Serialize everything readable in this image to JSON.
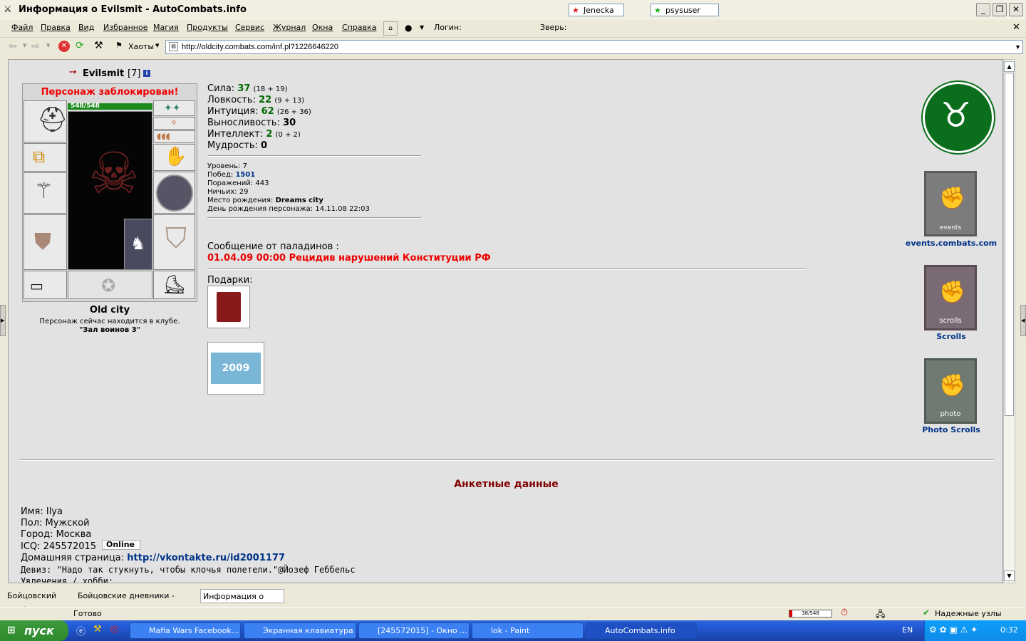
{
  "window": {
    "title": "Информация о Evilsmit - AutoCombats.info",
    "user1": "Jenecka",
    "user2": "psysuser"
  },
  "menu": [
    "Файл",
    "Правка",
    "Вид",
    "Избранное",
    "Магия",
    "Продукты",
    "Сервис",
    "Журнал",
    "Окна",
    "Справка"
  ],
  "toolbar": {
    "login_label": "Логин:",
    "beast_label": "Зверь:",
    "chaos_label": "Хаоты",
    "url": "http://oldcity.combats.com/inf.pl?1226646220"
  },
  "character": {
    "name": "Evilsmit",
    "level": "[7]",
    "blocked": "Персонаж заблокирован!",
    "hp": "548/548",
    "city": "Old city",
    "location_text": "Персонаж сейчас находится в клубе.",
    "location_room": "\"Зал воинов 3\""
  },
  "stats": [
    {
      "label": "Сила:",
      "value": "37",
      "detail": "(18 + 19)"
    },
    {
      "label": "Ловкость:",
      "value": "22",
      "detail": "(9 + 13)"
    },
    {
      "label": "Интуиция:",
      "value": "62",
      "detail": "(26 + 36)"
    },
    {
      "label": "Выносливость:",
      "value": "30",
      "detail": ""
    },
    {
      "label": "Интеллект:",
      "value": "2",
      "detail": "(0 + 2)"
    },
    {
      "label": "Мудрость:",
      "value": "0",
      "detail": ""
    }
  ],
  "info": {
    "level": "Уровень: 7",
    "wins_label": "Побед:",
    "wins": "1501",
    "losses": "Поражений: 443",
    "draws": "Ничьих: 29",
    "birthplace_label": "Место рождения:",
    "birthplace": "Dreams city",
    "birthday": "День рождения персонажа: 14.11.08 22:03"
  },
  "paladin": {
    "label": "Сообщение от паладинов :",
    "message": "01.04.09 00:00 Рецидив нарушений Конституции РФ"
  },
  "gifts_label": "Подарки:",
  "gift2_label": "2009",
  "side_links": [
    {
      "caption": "events.combats.com",
      "sign": "events"
    },
    {
      "caption": "Scrolls",
      "sign": "scrolls"
    },
    {
      "caption": "Photo Scrolls",
      "sign": "photo"
    }
  ],
  "profile": {
    "heading": "Анкетные данные",
    "name": "Имя: Ilya",
    "sex": "Пол: Мужской",
    "city": "Город: Москва",
    "icq": "ICQ: 245572015",
    "online": "Online",
    "homepage_label": "Домашняя страница:",
    "homepage": "http://vkontakte.ru/id2001177",
    "motto": "Девиз: \"Надо так стукнуть, чтобы клочья полетели.\"@Йозеф Геббельс",
    "hobbies": "Увлечения / хобби:"
  },
  "tabs": [
    "Бойцовский клуб",
    "Бойцовские дневники - scrolls...",
    "Информация о Evilsmit"
  ],
  "status": {
    "ready": "Готово",
    "hp_mini": "38/548",
    "trusted": "Надежные узлы"
  },
  "taskbar": {
    "start": "пуск",
    "tasks": [
      "Mafia Wars Facebook...",
      "Экранная клавиатура",
      "[245572015] - Окно ...",
      "lok - Paint",
      "AutoCombats.info"
    ],
    "lang": "EN",
    "time": "0:32"
  }
}
